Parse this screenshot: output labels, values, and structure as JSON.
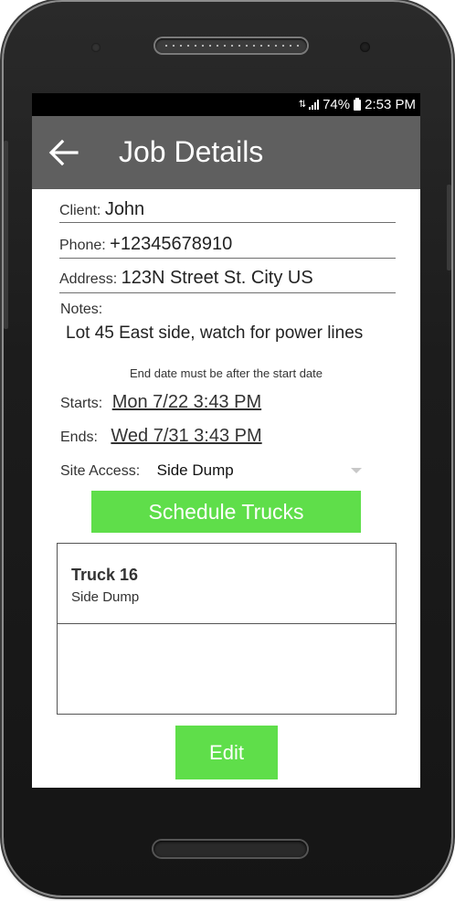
{
  "status_bar": {
    "battery": "74%",
    "time": "2:53 PM"
  },
  "app_bar": {
    "title": "Job Details"
  },
  "job": {
    "client_label": "Client:",
    "client_value": "John",
    "phone_label": "Phone:",
    "phone_value": "+12345678910",
    "address_label": "Address:",
    "address_value": "123N Street St. City US",
    "notes_label": "Notes:",
    "notes_value": "Lot 45 East side, watch for power lines",
    "date_warning": "End date must be after the start date",
    "starts_label": "Starts:",
    "starts_value": "Mon 7/22 3:43 PM",
    "ends_label": "Ends:",
    "ends_value": "Wed 7/31 3:43 PM",
    "site_access_label": "Site Access:",
    "site_access_value": "Side Dump"
  },
  "buttons": {
    "schedule": "Schedule Trucks",
    "edit": "Edit"
  },
  "trucks": [
    {
      "name": "Truck 16",
      "type": "Side Dump"
    }
  ],
  "colors": {
    "accent_green": "#5fde4a",
    "app_bar": "#5f5f5f",
    "status_bar": "#000000"
  },
  "icons": {
    "back": "arrow-left-icon",
    "signal": "signal-icon",
    "battery": "battery-icon",
    "sim": "sim-icon",
    "dropdown": "chevron-down-icon"
  }
}
